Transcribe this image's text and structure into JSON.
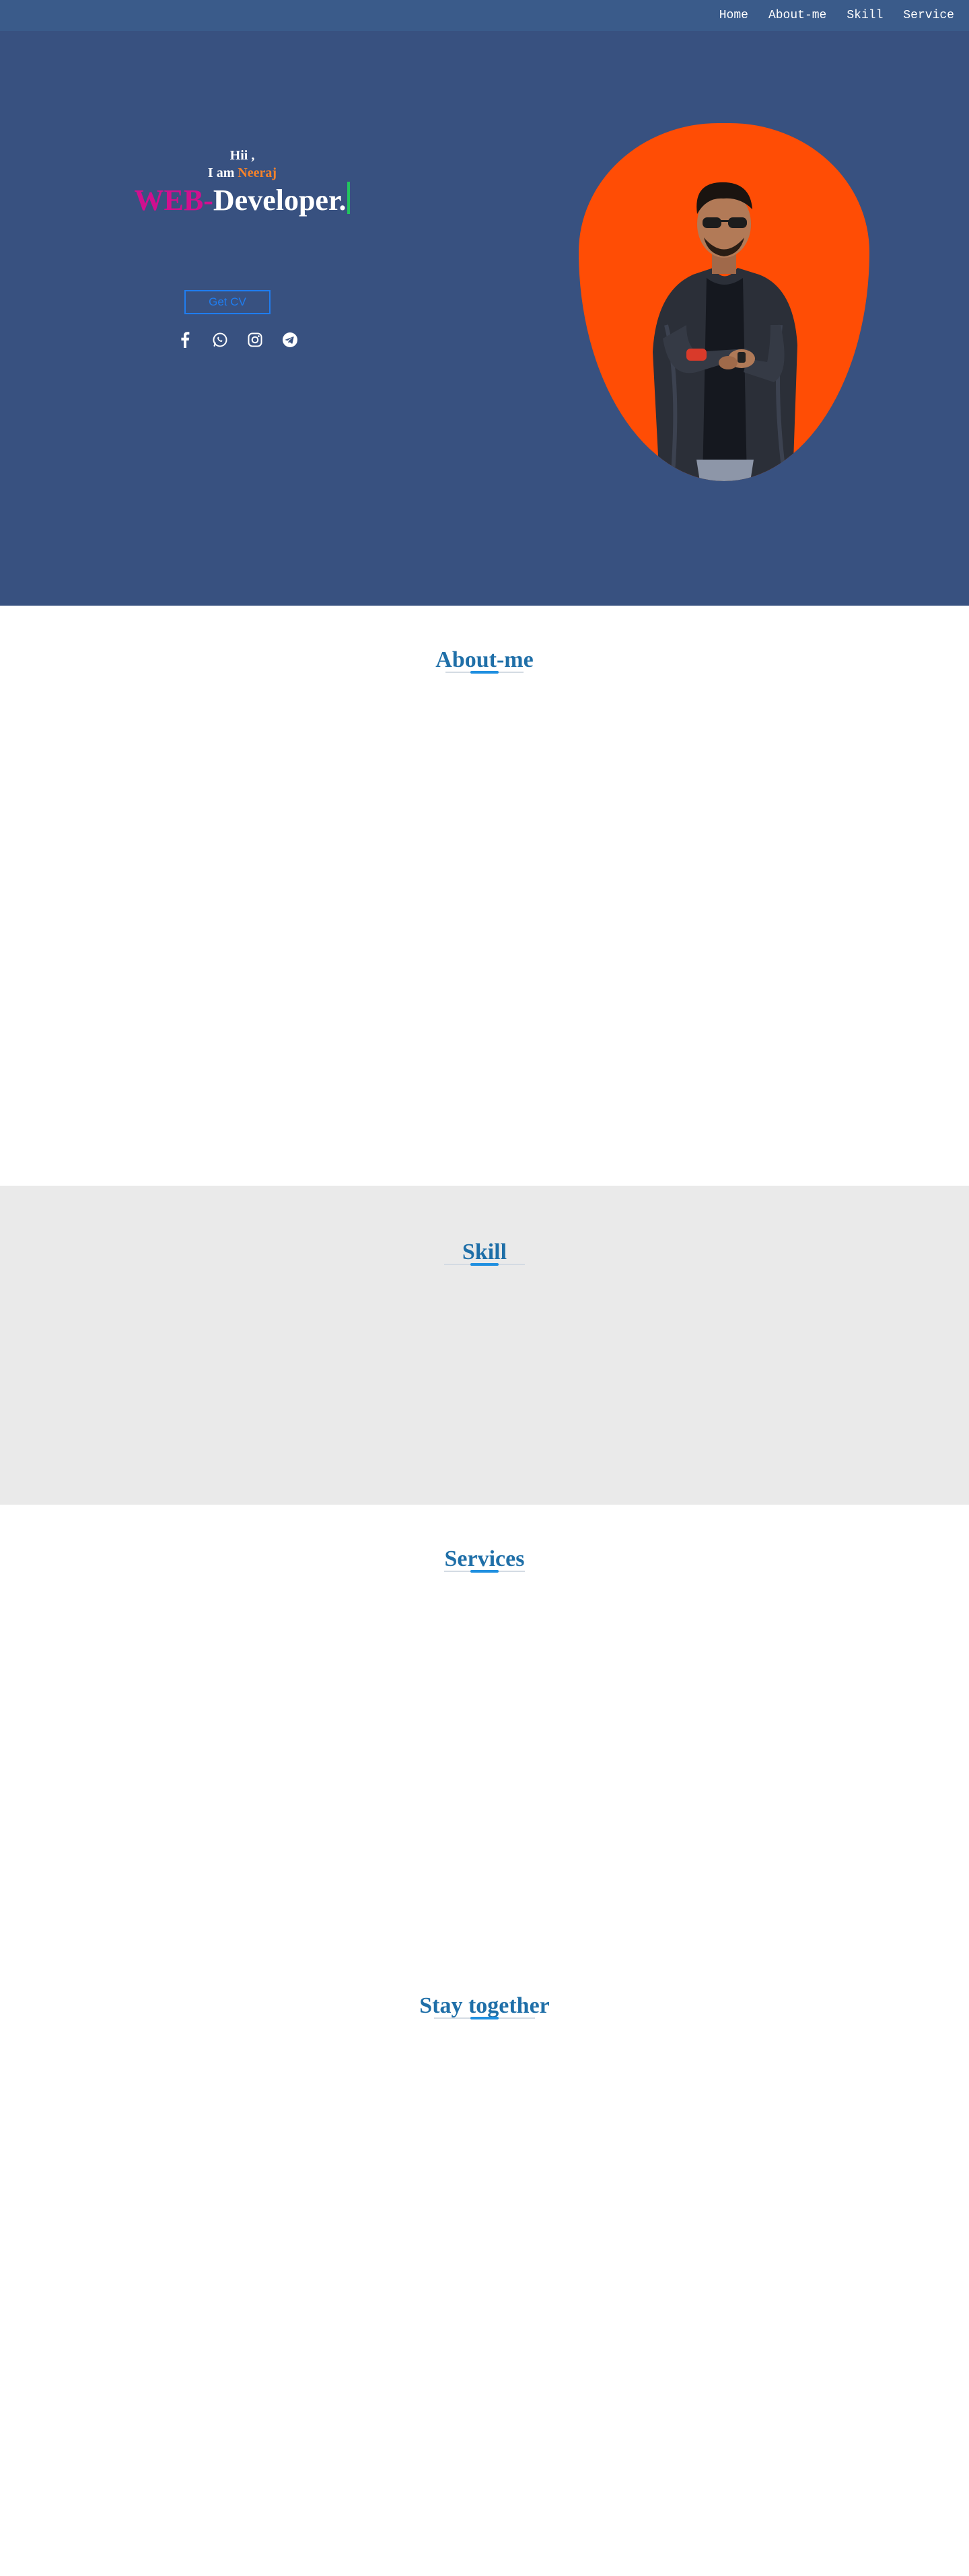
{
  "nav": {
    "items": [
      {
        "label": "Home"
      },
      {
        "label": "About-me"
      },
      {
        "label": "Skill"
      },
      {
        "label": "Service"
      }
    ]
  },
  "hero": {
    "greeting": "Hii ,",
    "iam_prefix": "I am",
    "name": "Neeraj",
    "role_web": "WEB",
    "role_dash": "-",
    "role_dev": "Developer.",
    "cv_button": "Get CV",
    "socials": [
      "facebook-icon",
      "whatsapp-icon",
      "instagram-icon",
      "telegram-icon"
    ]
  },
  "sections": {
    "about_title": "About-me",
    "skill_title": "Skill",
    "services_title": "Services",
    "stay_title": "Stay together"
  },
  "colors": {
    "hero_bg": "#385180",
    "nav_bg": "#3a5b8a",
    "accent_orange": "#ff4d05",
    "name_orange": "#f5822a",
    "web_pink": "#d10f8f",
    "title_blue": "#1f6fa8",
    "button_blue": "#1f7df0",
    "skill_bg": "#eaeaea"
  }
}
